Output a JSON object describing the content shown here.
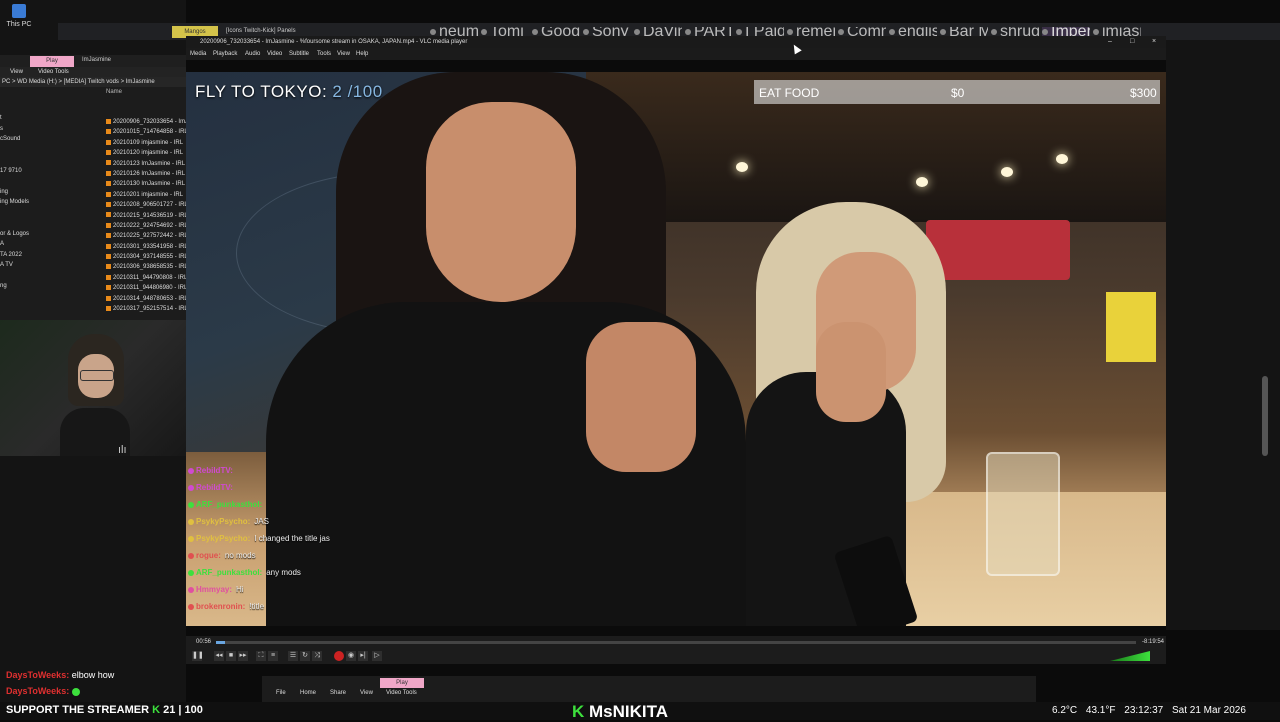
{
  "desktop": {
    "this_pc_label": "This PC"
  },
  "explorer": {
    "play_tab": "Play",
    "user_tab": "ImJasmine",
    "file": "File",
    "home": "Home",
    "view": "View",
    "video_tools": "Video Tools",
    "address": "PC  >  WD Media (H:)  >  [MEDIA] Twitch vods  >  ImJasmine",
    "column_name": "Name",
    "nav_items": [
      "t",
      "s",
      "cSound",
      "",
      "",
      "17 9710",
      "",
      "ing",
      "ing Models",
      "",
      "",
      "or & Logos",
      "A",
      "TA 2022",
      "A TV",
      "",
      "ng"
    ],
    "files": [
      "20200906_732033654 - ImJ",
      "20201015_714764858 - IRL",
      "20210109 imjasmine - IRL",
      "20210120 imjasmine - IRL",
      "20210123 ImJasmine - IRL",
      "20210126 ImJasmine - IRL",
      "20210130 ImJasmine - IRL",
      "20210201 imjasmine - IRL",
      "20210208_906501727 - IRL",
      "20210215_914536519 - IRL",
      "20210222_924754692 - IRL",
      "20210225_927572442 - IRL",
      "20210301_933541958 - IRL",
      "20210304_937148555 - IRL",
      "20210306_938658535 - IRL",
      "20210311_944790808 - IRL",
      "20210311_944806980 - IRL",
      "20210314_948780653 - IRL",
      "20210317_952157514 - IRL"
    ]
  },
  "browser": {
    "mangos_tab": "Mangos",
    "panels_tab": "[Icons Twitch-Kick] Panels",
    "tabs": [
      "neuma ic",
      "Tomi Örök",
      "Google N",
      "Sony 18-",
      "DaVinci R",
      "PART 2 - L",
      "I Paid Jap",
      "remembr",
      "Commerc",
      "english tr",
      "Bar Manu",
      "shrug.s...",
      "Imperi",
      "imjasmine"
    ]
  },
  "vlc": {
    "title": "20200906_732033654 - ImJasmine - %foursome stream in OSAKA, JAPAN.mp4 - VLC media player",
    "menu": [
      "Media",
      "Playback",
      "Audio",
      "Video",
      "Subtitle",
      "Tools",
      "View",
      "Help"
    ],
    "elapsed": "00:56",
    "total": "-8:19:54",
    "progress_fraction": 0.01,
    "controls": [
      "pause-icon",
      "prev-icon",
      "stop-icon",
      "next-icon",
      "fullscreen-icon",
      "extended-icon",
      "playlist-icon",
      "loop-icon",
      "shuffle-icon",
      "record-icon",
      "snapshot-icon",
      "frame-icon",
      "ab-loop-icon"
    ]
  },
  "overlay": {
    "tokyo_label": "FLY TO TOKYO:",
    "tokyo_count": "2 /100",
    "food_label": "EAT FOOD",
    "food_current": "$0",
    "food_goal": "$300"
  },
  "chat": [
    {
      "user": "RebildTV:",
      "msg": "",
      "color": "#d04ad0"
    },
    {
      "user": "RebildTV:",
      "msg": "",
      "color": "#d04ad0"
    },
    {
      "user": "ARF_punkasthol:",
      "msg": "",
      "color": "#3de03d"
    },
    {
      "user": "PsykyPsycho:",
      "msg": "JAS",
      "color": "#e0c040"
    },
    {
      "user": "PsykyPsycho:",
      "msg": "I changed the title jas",
      "color": "#e0c040"
    },
    {
      "user": "rogue:",
      "msg": "no mods",
      "color": "#e05050"
    },
    {
      "user": "ARF_punkasthol:",
      "msg": "any mods",
      "color": "#3de03d"
    },
    {
      "user": "Hmmyay:",
      "msg": "Hi",
      "color": "#e050a0"
    },
    {
      "user": "brokenronin:",
      "msg": "!title",
      "color": "#e05050"
    }
  ],
  "ticker": {
    "line1_user": "DaysToWeeks:",
    "line1_msg": "elbow how",
    "line2_user": "DaysToWeeks:",
    "line2_msg": ""
  },
  "support": {
    "label": "SUPPORT THE STREAMER",
    "current": "21",
    "goal": "100"
  },
  "kick": {
    "k": "K",
    "name": "MsNIKITA"
  },
  "clock": {
    "temp_c": "6.2°C",
    "temp_f": "43.1°F",
    "time": "23:12:37",
    "date": "Sat 21 Mar 2026"
  },
  "small_explorer": {
    "play": "Play",
    "file": "File",
    "home": "Home",
    "share": "Share",
    "view": "View",
    "video_tools": "Video Tools"
  },
  "colors": {
    "vlc_accent": "#6aa6e0",
    "kick_green": "#3de03d",
    "play_tab": "#f0a7c8"
  }
}
